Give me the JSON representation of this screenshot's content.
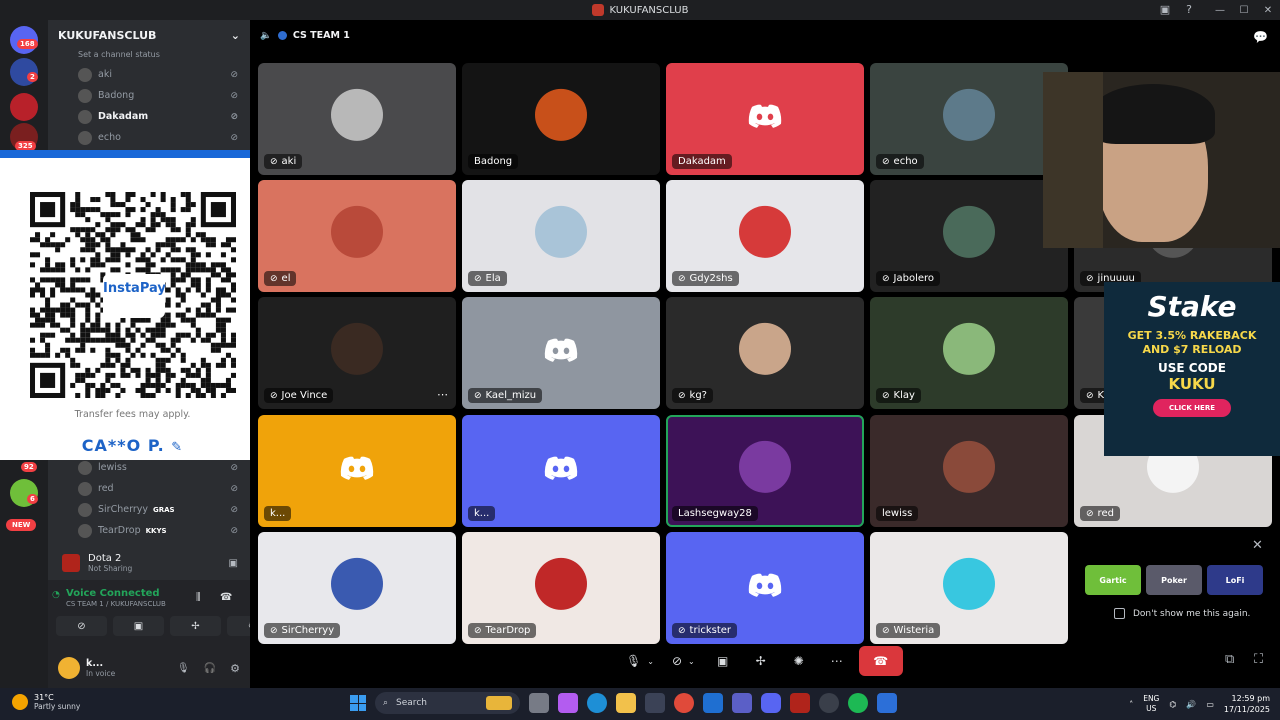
{
  "window": {
    "title": "KUKUFANSCLUB"
  },
  "rail": {
    "badges": [
      "168",
      "2",
      "325",
      "92",
      "6"
    ],
    "new_label": "NEW"
  },
  "sidebar": {
    "server_name": "KUKUFANSCLUB",
    "channel_status": "Set a channel status",
    "voice_users_top": [
      {
        "name": "aki"
      },
      {
        "name": "Badong"
      },
      {
        "name": "Dakadam"
      },
      {
        "name": "echo"
      }
    ],
    "voice_users_bottom": [
      {
        "name": "lewiss",
        "tag": ""
      },
      {
        "name": "red",
        "tag": ""
      },
      {
        "name": "SirCherryy",
        "tag": "GRAS"
      },
      {
        "name": "TearDrop",
        "tag": "KKYS"
      }
    ],
    "activity": {
      "game": "Dota 2",
      "status": "Not Sharing"
    },
    "voice": {
      "status": "Voice Connected",
      "channel": "CS TEAM 1 / KUKUFANSCLUB"
    },
    "user": {
      "name": "k...",
      "status": "In voice"
    }
  },
  "qr_overlay": {
    "brand": "InstaPay",
    "fee_note": "Transfer fees may apply.",
    "account_name": "CA**O P."
  },
  "call": {
    "channel": "CS TEAM 1",
    "tiles": [
      {
        "name": "aki",
        "bg": "#4a4a4c",
        "kind": "photo",
        "avatar": "#b8b8b8"
      },
      {
        "name": "Badong",
        "bg": "#141414",
        "kind": "photo",
        "avatar": "#c8501a"
      },
      {
        "name": "Dakadam",
        "bg": "#e03f4b",
        "kind": "discord"
      },
      {
        "name": "echo",
        "bg": "#3a4440",
        "kind": "photo",
        "avatar": "#5d7a8a"
      },
      {
        "name": "el",
        "bg": "#d9735f",
        "kind": "photo",
        "avatar": "#b94a3a"
      },
      {
        "name": "Ela",
        "bg": "#e2e2e6",
        "kind": "photo",
        "avatar": "#a9c4d8"
      },
      {
        "name": "Gdy2shs",
        "bg": "#e6e6ea",
        "kind": "photo",
        "avatar": "#d63a3a"
      },
      {
        "name": "Jabolero",
        "bg": "#222222",
        "kind": "photo",
        "avatar": "#4a6a5a"
      },
      {
        "name": "Joe Vince",
        "bg": "#1f1f1f",
        "kind": "photo",
        "avatar": "#3a2a22"
      },
      {
        "name": "Kael_mizu",
        "bg": "#8f96a0",
        "kind": "discord"
      },
      {
        "name": "kg?",
        "bg": "#2a2a2a",
        "kind": "photo",
        "avatar": "#c9a58a"
      },
      {
        "name": "Klay",
        "bg": "#2d3b2a",
        "kind": "photo",
        "avatar": "#8ab87a"
      },
      {
        "name": "k...",
        "bg": "#f0a30a",
        "kind": "discord"
      },
      {
        "name": "k...",
        "bg": "#5865f2",
        "kind": "discord"
      },
      {
        "name": "Lashsegway28",
        "bg": "#3d1257",
        "kind": "photo",
        "avatar": "#7a3aa0"
      },
      {
        "name": "lewiss",
        "bg": "#3a2a2a",
        "kind": "photo",
        "avatar": "#8a4a3a"
      },
      {
        "name": "SirCherryy",
        "bg": "#e8e8ec",
        "kind": "photo",
        "avatar": "#3a5ab0"
      },
      {
        "name": "TearDrop",
        "bg": "#f0e8e4",
        "kind": "photo",
        "avatar": "#c02828"
      },
      {
        "name": "trickster",
        "bg": "#5865f2",
        "kind": "discord"
      },
      {
        "name": "Wisteria",
        "bg": "#ebe8e8",
        "kind": "photo",
        "avatar": "#38c7e0"
      },
      {
        "name": "jinuuuu",
        "bg": "#2b2b2b",
        "kind": "photo",
        "avatar": "#555"
      },
      {
        "name": "K",
        "bg": "#3a3a3a",
        "kind": "photo",
        "avatar": "#666"
      },
      {
        "name": "red",
        "bg": "#d9d6d4",
        "kind": "photo",
        "avatar": "#f4f4f4"
      }
    ]
  },
  "ad": {
    "brand": "Stake",
    "line1": "GET 3.5% RAKEBACK",
    "line2": "AND $7 RELOAD",
    "use_code": "USE CODE",
    "code": "KUKU",
    "cta": "CLICK HERE"
  },
  "activities": {
    "thumbs": [
      "Gartic",
      "Poker",
      "LoFi"
    ],
    "dont_show": "Don't show me this again."
  },
  "taskbar": {
    "temp": "31°C",
    "weather": "Partly sunny",
    "search_placeholder": "Search",
    "lang1": "ENG",
    "lang2": "US",
    "time": "12:59 pm",
    "date": "17/11/2025"
  },
  "colors": {
    "discord_blurple": "#5865f2",
    "green": "#23a55a",
    "red": "#da373c"
  }
}
